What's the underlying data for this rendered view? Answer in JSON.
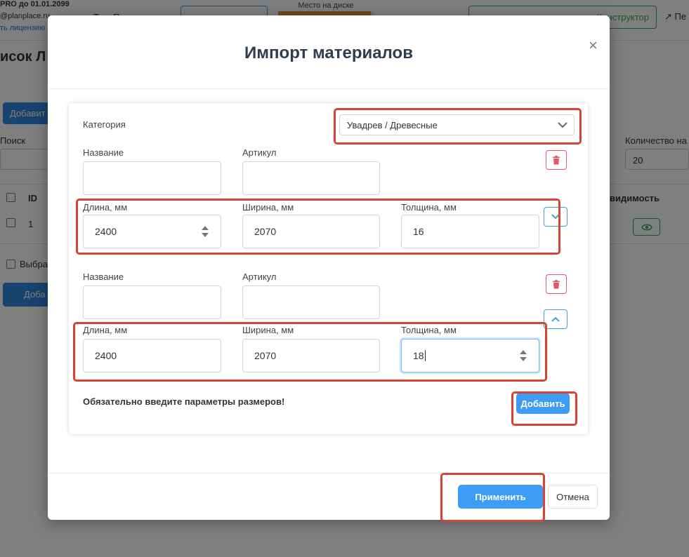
{
  "background": {
    "license_line": "PRO до 01.01.2099",
    "email_line": "@planplace.ru",
    "license_link": "ть лицензию",
    "support_text": "Тех. Поддержка",
    "disk_label": "Место на диске",
    "disk_used_fraction": 0.97,
    "constructor_button": "Конструктор",
    "exit_link": "Пе",
    "page_title": "исок Л",
    "add_button": "Добавит",
    "search_label": "Поиск",
    "count_label": "Количество на",
    "count_value": "20",
    "table_headers": {
      "id": "ID",
      "visibility": "видимость"
    },
    "row_id": "1",
    "select_label": "Выбра",
    "add_button_2": "Доба"
  },
  "modal": {
    "title": "Импорт материалов",
    "close_symbol": "×",
    "category_label": "Категория",
    "category_value": "Увадрев / Древесные",
    "blocks": [
      {
        "name_label": "Название",
        "name_value": "",
        "article_label": "Артикул",
        "article_value": "",
        "length_label": "Длина, мм",
        "length_value": "2400",
        "width_label": "Ширина, мм",
        "width_value": "2070",
        "thickness_label": "Толщина, мм",
        "thickness_value": "16"
      },
      {
        "name_label": "Название",
        "name_value": "",
        "article_label": "Артикул",
        "article_value": "",
        "length_label": "Длина, мм",
        "length_value": "2400",
        "width_label": "Ширина, мм",
        "width_value": "2070",
        "thickness_label": "Толщина, мм",
        "thickness_value": "18"
      }
    ],
    "warning": "Обязательно введите параметры размеров!",
    "add_button": "Добавить",
    "apply_button": "Применить",
    "cancel_button": "Отмена"
  },
  "colors": {
    "primary": "#3d9cf3",
    "annotation": "#d94332",
    "danger": "#e2576a",
    "success": "#3aa657"
  }
}
